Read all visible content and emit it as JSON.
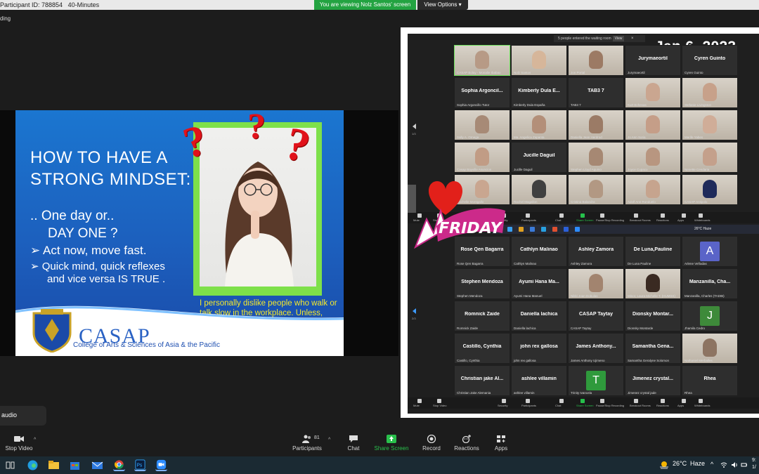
{
  "meeting": {
    "participant_id": "Participant ID: 788854",
    "timer": "40-Minutes",
    "viewing_banner": "You are viewing Nolz Santos' screen",
    "view_options": "View Options",
    "recording_fragment": "ding"
  },
  "slide": {
    "title_line1": "HOW TO HAVE A",
    "title_line2": "STRONG MINDSET:",
    "line1": ".. One day or..",
    "line2": "DAY ONE ?",
    "bullet1": "Act now, move fast.",
    "bullet2": "Quick mind, quick reflexes",
    "bullet2b": "and vice versa IS TRUE .",
    "caption": "I personally dislike people who walk or talk slow in the workplace. Unless, exceptionally productive.",
    "org_name": "CASAP",
    "org_full": "College of Arts & Sciences of Asia & the Pacific",
    "colors": {
      "background": "#1c66c4",
      "frame": "#7ee04a",
      "caption": "#f5e92a",
      "question_marks": "#e1121a"
    }
  },
  "gallery": {
    "date": "Jan 6, 2023",
    "waiting_room": "5 people entered the waiting room",
    "waiting_view": "View",
    "top_grid": [
      {
        "label": "CASAP Bolay - Monalie Ibabao",
        "name": "",
        "video": true,
        "active": true,
        "tone": "#b79a86"
      },
      {
        "label": "Nolz Santos",
        "name": "",
        "video": true,
        "tone": "#d6b69a"
      },
      {
        "label": "Jon Portal",
        "name": "",
        "video": true,
        "tone": "#9c7a64"
      },
      {
        "label": "Jurymaeortil",
        "name": "Jurymaeortil",
        "video": false
      },
      {
        "label": "Cyren Guinto",
        "name": "Cyren Guinto",
        "video": false
      },
      {
        "label": "Sophia Argoncillo Tutor",
        "name": "Sophia  Argoncil...",
        "video": false
      },
      {
        "label": "Kimberly Dula España",
        "name": "Kimberly Dula E...",
        "video": false
      },
      {
        "label": "TAB3 7",
        "name": "TAB3 7",
        "video": false
      },
      {
        "label": "Kurt Echevas",
        "name": "",
        "video": true,
        "tone": "#caa690"
      },
      {
        "label": "Stefanie Livingston",
        "name": "",
        "video": true,
        "tone": "#c7a18a"
      },
      {
        "label": "Sally A. Ornega",
        "name": "",
        "video": true,
        "tone": "#a78a76"
      },
      {
        "label": "Ma. Angelica Zapanta",
        "name": "",
        "video": true,
        "tone": "#b38f79"
      },
      {
        "label": "Daniella Jean Herdrod",
        "name": "",
        "video": true,
        "tone": "#9b7b66"
      },
      {
        "label": "Jo Ann Soria",
        "name": "",
        "video": true,
        "tone": "#c59e88"
      },
      {
        "label": "Marife Yabes",
        "name": "",
        "video": true,
        "tone": "#d0ad98"
      },
      {
        "label": "Casap Bayville Asuncion",
        "name": "",
        "video": true,
        "tone": "#c19c85"
      },
      {
        "label": "Jucille Daguil",
        "name": "Jucille Daguil",
        "video": false
      },
      {
        "label": "Stephen Lloyd Aquino",
        "name": "",
        "video": true,
        "tone": "#a68873"
      },
      {
        "label": "Joyce Cupaco",
        "name": "",
        "video": true,
        "tone": "#b89680"
      },
      {
        "label": "Nenette Cendaria",
        "name": "",
        "video": true,
        "tone": "#c4a08b"
      },
      {
        "label": "Rachelle Montgallo",
        "name": "",
        "video": true,
        "tone": "#c9a690"
      },
      {
        "label": "Rachel Magallon",
        "name": "",
        "video": true,
        "tone": "#404040"
      },
      {
        "label": "Cristina Balandra",
        "name": "",
        "video": true,
        "tone": "#b29883"
      },
      {
        "label": "Adolf Ann Ronduelo",
        "name": "",
        "video": true,
        "tone": "#c6a48e"
      },
      {
        "label": "CASAP Antipolo",
        "name": "",
        "video": true,
        "tone": "#1e2a5a"
      }
    ],
    "bottom_grid": [
      {
        "label": "Rose Qen Bagarra",
        "name": "Rose Qen Bagarra"
      },
      {
        "label": "Cathlyn Malinao",
        "name": "Cathlyn Malinao"
      },
      {
        "label": "Ashley Zamora",
        "name": "Ashley Zamora"
      },
      {
        "label": "De Luna Pauline",
        "name": "De Luna,Pauline"
      },
      {
        "label": "Arlene Veñadas",
        "name": "",
        "avatar": "A",
        "avatar_color": "#5a64c8"
      },
      {
        "label": "Stephen Mendoza",
        "name": "Stephen Mendoza"
      },
      {
        "label": "Ayumi Hana Manuel",
        "name": "Ayumi Hana Ma..."
      },
      {
        "label": "Nikki Joan Dobulas",
        "name": "",
        "video": true,
        "tone": "#a2846f"
      },
      {
        "label": "Minor, Laura Michelle T. (HUMSS)",
        "name": "",
        "video": true,
        "tone": "#3a2a22"
      },
      {
        "label": "Manzanilla, Charles (TADIB)",
        "name": "Manzanilla,  Cha..."
      },
      {
        "label": "Romnick Zaide",
        "name": "Romnick Zaide"
      },
      {
        "label": "Daniella lachica",
        "name": "Daniella lachica"
      },
      {
        "label": "CASAP Taytay",
        "name": "CASAP Taytay"
      },
      {
        "label": "Dionsky Montarde",
        "name": "Dionsky  Montar..."
      },
      {
        "label": "Jhamila Cedro",
        "name": "",
        "avatar": "J",
        "avatar_color": "#3e8a3a"
      },
      {
        "label": "Castillo, Cynthia",
        "name": "Castillo, Cynthia"
      },
      {
        "label": "john rex gallosa",
        "name": "john rex gallosa"
      },
      {
        "label": "James Anthony Ujimeno",
        "name": "James  Anthony..."
      },
      {
        "label": "Samantha Geralyne Solomon",
        "name": "Samantha  Gena..."
      },
      {
        "label": "Nathaniel Merballes",
        "name": "",
        "video": true,
        "tone": "#8d7462"
      },
      {
        "label": "Christian Jake Alemania",
        "name": "Christian jake Al..."
      },
      {
        "label": "ashlee villamin",
        "name": "ashlee villamin"
      },
      {
        "label": "Trinity Ivancela",
        "name": "",
        "avatar": "T",
        "avatar_color": "#2f9a3c"
      },
      {
        "label": "Jimenez crystal jade",
        "name": "Jimenez  crystal..."
      },
      {
        "label": "Rhea",
        "name": "Rhea"
      }
    ],
    "mini_toolbar": [
      "Mute",
      "Stop Video",
      "Security",
      "Participants",
      "Chat",
      "Share Screen",
      "Pause/Stop Recording",
      "Breakout Rooms",
      "Reactions",
      "Apps",
      "Whiteboards"
    ],
    "participants_count_small": "81",
    "weather_small": "26°C  Haze",
    "page_top": "1/3",
    "page_bottom": "2/3"
  },
  "sticker": {
    "text": "FRIDAY"
  },
  "controls": {
    "audio_pill": "audio",
    "stop_video": "Stop Video",
    "participants": "Participants",
    "participants_count": "81",
    "chat": "Chat",
    "share_screen": "Share Screen",
    "record": "Record",
    "reactions": "Reactions",
    "apps": "Apps"
  },
  "taskbar": {
    "temperature": "26°C",
    "weather": "Haze",
    "time_fragment": "9:",
    "date_fragment": "1/"
  }
}
